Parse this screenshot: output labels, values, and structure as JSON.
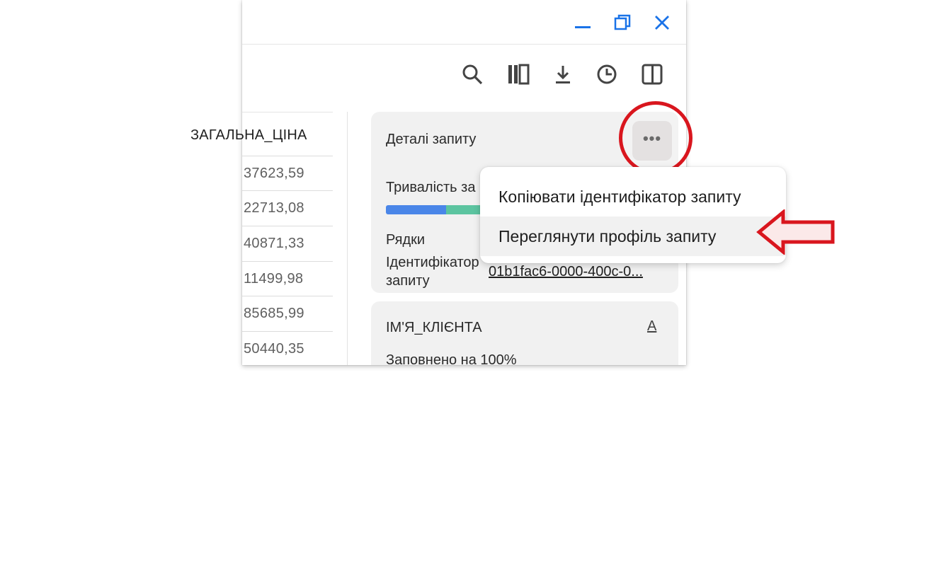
{
  "window_controls": {
    "minimize_icon": "minimize-icon",
    "maximize_icon": "maximize-icon",
    "close_icon": "close-icon"
  },
  "toolbar": {
    "icons": [
      "search-icon",
      "columns-icon",
      "download-icon",
      "history-icon",
      "panel-icon"
    ]
  },
  "grid": {
    "column_header": "ЗАГАЛЬНА_ЦІНА",
    "rows": [
      "37623,59",
      "22713,08",
      "40871,33",
      "11499,98",
      "85685,99",
      "50440,35"
    ]
  },
  "details_card": {
    "title": "Деталі запиту",
    "more_button": "•••",
    "duration_label": "Тривалість за",
    "rows_label": "Рядки",
    "query_id_label_line1": "Ідентифікатор",
    "query_id_label_line2": "запиту",
    "query_id_value": "01b1fac6-0000-400c-0..."
  },
  "column_card": {
    "title": "ІМ'Я_КЛІЄНТА",
    "type_icon": "A",
    "fill_text": "Заповнено на 100%"
  },
  "context_menu": {
    "items": [
      "Копіювати ідентифікатор запиту",
      "Переглянути профіль запиту"
    ]
  },
  "annotation": {
    "highlight_color": "#d9161e"
  }
}
